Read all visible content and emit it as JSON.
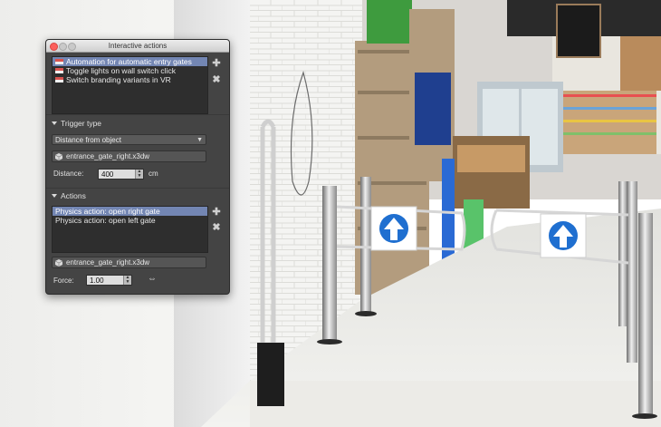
{
  "window": {
    "title": "Interactive actions"
  },
  "automations": {
    "items": [
      {
        "label": "Automation for automatic entry gates",
        "selected": true
      },
      {
        "label": "Toggle lights on wall switch click",
        "selected": false
      },
      {
        "label": "Switch branding variants in VR",
        "selected": false
      }
    ],
    "add_icon": "plus-icon",
    "remove_icon": "x-icon"
  },
  "trigger": {
    "section_label": "Trigger type",
    "type_value": "Distance from object",
    "object_file": "entrance_gate_right.x3dw",
    "distance_label": "Distance:",
    "distance_value": "400",
    "distance_unit": "cm"
  },
  "actions": {
    "section_label": "Actions",
    "items": [
      {
        "label": "Physics action: open right gate",
        "selected": true
      },
      {
        "label": "Physics action: open left gate",
        "selected": false
      }
    ],
    "object_file": "entrance_gate_right.x3dw",
    "force_label": "Force:",
    "force_value": "1.00"
  },
  "gate_signs": [
    "up-arrow-icon",
    "up-arrow-icon"
  ],
  "colors": {
    "panel_bg": "#444444",
    "selection": "#7386b3",
    "sign_blue": "#1f6fd0"
  }
}
